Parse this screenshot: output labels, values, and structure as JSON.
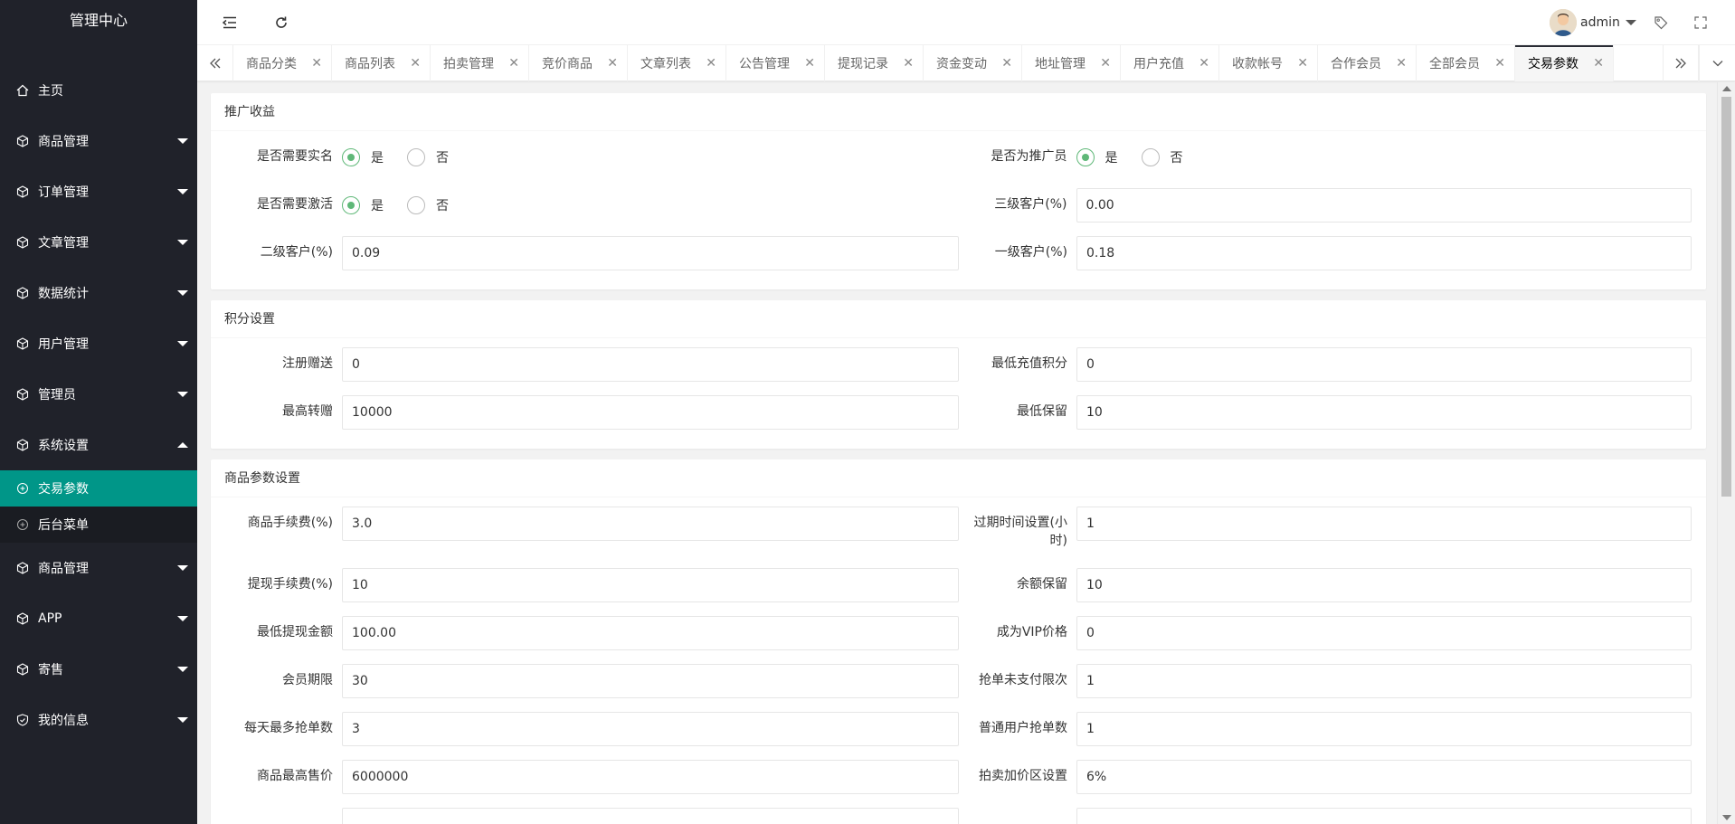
{
  "brand": "管理中心",
  "sidebar": {
    "items": [
      {
        "label": "主页",
        "icon": "home-icon"
      },
      {
        "label": "商品管理",
        "icon": "cube-icon"
      },
      {
        "label": "订单管理",
        "icon": "cube-icon"
      },
      {
        "label": "文章管理",
        "icon": "cube-icon"
      },
      {
        "label": "数据统计",
        "icon": "cube-icon"
      },
      {
        "label": "用户管理",
        "icon": "cube-icon"
      },
      {
        "label": "管理员",
        "icon": "cube-icon"
      },
      {
        "label": "系统设置",
        "icon": "cube-icon"
      }
    ],
    "sub_items": [
      {
        "label": "交易参数",
        "icon": "plus-circle-icon"
      },
      {
        "label": "后台菜单",
        "icon": "plus-circle-icon"
      }
    ],
    "items_after": [
      {
        "label": "商品管理",
        "icon": "cube-icon"
      },
      {
        "label": "APP",
        "icon": "cube-icon"
      },
      {
        "label": "寄售",
        "icon": "cube-icon"
      },
      {
        "label": "我的信息",
        "icon": "shield-check-icon"
      }
    ]
  },
  "header": {
    "username": "admin"
  },
  "tabs": [
    "商品分类",
    "商品列表",
    "拍卖管理",
    "竞价商品",
    "文章列表",
    "公告管理",
    "提现记录",
    "资金变动",
    "地址管理",
    "用户充值",
    "收款帐号",
    "合作会员",
    "全部会员",
    "交易参数"
  ],
  "sections": {
    "promo": {
      "title": "推广收益",
      "need_realname": {
        "label": "是否需要实名",
        "yes": "是",
        "no": "否"
      },
      "is_promoter": {
        "label": "是否为推广员",
        "yes": "是",
        "no": "否"
      },
      "need_activate": {
        "label": "是否需要激活",
        "yes": "是",
        "no": "否"
      },
      "level3": {
        "label": "三级客户(%)",
        "value": "0.00"
      },
      "level2": {
        "label": "二级客户(%)",
        "value": "0.09"
      },
      "level1": {
        "label": "一级客户(%)",
        "value": "0.18"
      }
    },
    "points": {
      "title": "积分设置",
      "register_gift": {
        "label": "注册赠送",
        "value": "0"
      },
      "min_recharge_points": {
        "label": "最低充值积分",
        "value": "0"
      },
      "max_transfer": {
        "label": "最高转赠",
        "value": "10000"
      },
      "min_keep": {
        "label": "最低保留",
        "value": "10"
      }
    },
    "goods": {
      "title": "商品参数设置",
      "fee": {
        "label": "商品手续费(%)",
        "value": "3.0"
      },
      "expire": {
        "label": "过期时间设置(小时)",
        "value": "1"
      },
      "withdraw_fee": {
        "label": "提现手续费(%)",
        "value": "10"
      },
      "balance_keep": {
        "label": "余额保留",
        "value": "10"
      },
      "min_withdraw": {
        "label": "最低提现金额",
        "value": "100.00"
      },
      "vip_price": {
        "label": "成为VIP价格",
        "value": "0"
      },
      "member_period": {
        "label": "会员期限",
        "value": "30"
      },
      "unpaid_limit": {
        "label": "抢单未支付限次",
        "value": "1"
      },
      "daily_max": {
        "label": "每天最多抢单数",
        "value": "3"
      },
      "normal_grab": {
        "label": "普通用户抢单数",
        "value": "1"
      },
      "max_price": {
        "label": "商品最高售价",
        "value": "6000000"
      },
      "auction_markup": {
        "label": "拍卖加价区设置",
        "value": "6%"
      }
    }
  },
  "colors": {
    "sidebar_bg": "#20222a",
    "active": "#009688",
    "radio_on": "#5fb878"
  }
}
